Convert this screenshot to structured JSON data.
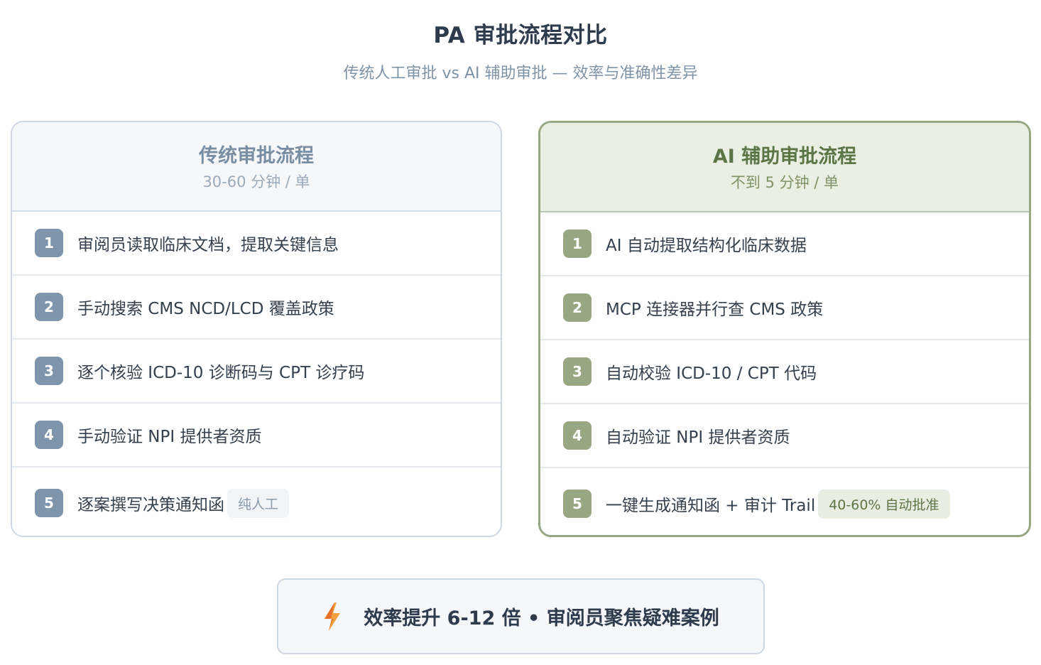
{
  "header": {
    "title": "PA 审批流程对比",
    "subtitle": "传统人工审批 vs AI 辅助审批 — 效率与准确性差异"
  },
  "traditional": {
    "title": "传统审批流程",
    "duration": "30-60 分钟 / 单",
    "steps": [
      {
        "num": "1",
        "text": "审阅员读取临床文档，提取关键信息"
      },
      {
        "num": "2",
        "text": "手动搜索 CMS NCD/LCD 覆盖政策"
      },
      {
        "num": "3",
        "text": "逐个核验 ICD-10 诊断码与 CPT 诊疗码"
      },
      {
        "num": "4",
        "text": "手动验证 NPI 提供者资质"
      },
      {
        "num": "5",
        "text": "逐案撰写决策通知函",
        "tag": "纯人工"
      }
    ]
  },
  "ai": {
    "title": "AI 辅助审批流程",
    "duration": "不到 5 分钟 / 单",
    "steps": [
      {
        "num": "1",
        "text": "AI 自动提取结构化临床数据"
      },
      {
        "num": "2",
        "text": "MCP 连接器并行查 CMS 政策"
      },
      {
        "num": "3",
        "text": "自动校验 ICD-10 / CPT 代码"
      },
      {
        "num": "4",
        "text": "自动验证 NPI 提供者资质"
      },
      {
        "num": "5",
        "text": "一键生成通知函 + 审计 Trail",
        "tag": "40-60% 自动批准"
      }
    ]
  },
  "footer": {
    "icon": "lightning-icon",
    "text": "效率提升 6-12 倍 • 审阅员聚焦疑难案例"
  }
}
